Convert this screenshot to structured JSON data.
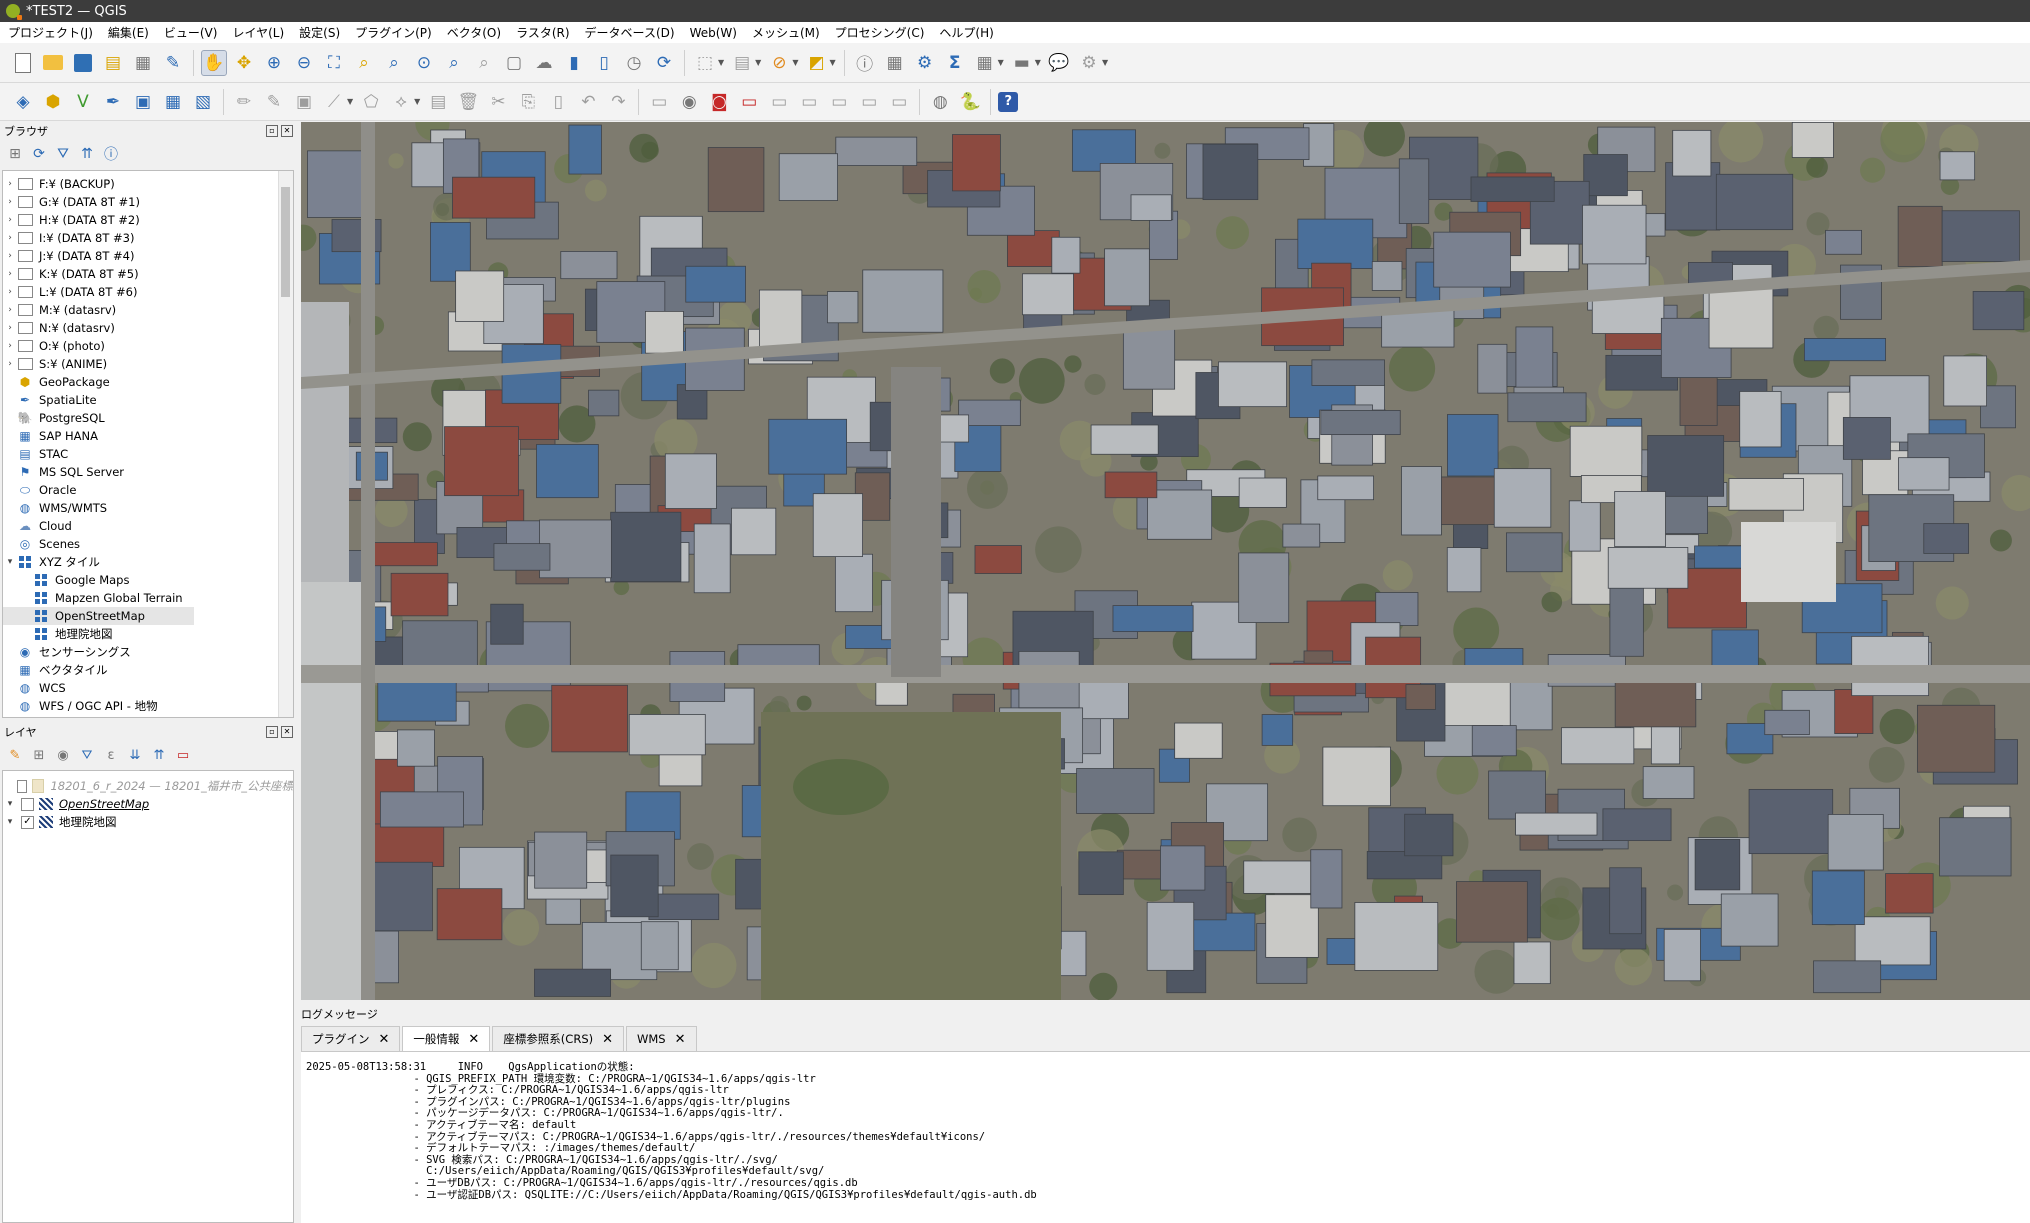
{
  "window": {
    "title": "*TEST2 — QGIS"
  },
  "menu": [
    "プロジェクト(J)",
    "編集(E)",
    "ビュー(V)",
    "レイヤ(L)",
    "設定(S)",
    "プラグイン(P)",
    "ベクタ(O)",
    "ラスタ(R)",
    "データベース(D)",
    "Web(W)",
    "メッシュ(M)",
    "プロセシング(C)",
    "ヘルプ(H)"
  ],
  "browser": {
    "title": "ブラウザ",
    "items": [
      {
        "label": "F:¥ (BACKUP)",
        "icon": "drive-icon",
        "expand": true,
        "indent": 0
      },
      {
        "label": "G:¥ (DATA 8T #1)",
        "icon": "drive-icon",
        "expand": true,
        "indent": 0
      },
      {
        "label": "H:¥ (DATA 8T #2)",
        "icon": "drive-icon",
        "expand": true,
        "indent": 0
      },
      {
        "label": "I:¥ (DATA 8T #3)",
        "icon": "drive-icon",
        "expand": true,
        "indent": 0
      },
      {
        "label": "J:¥ (DATA 8T #4)",
        "icon": "drive-icon",
        "expand": true,
        "indent": 0
      },
      {
        "label": "K:¥ (DATA 8T #5)",
        "icon": "drive-icon",
        "expand": true,
        "indent": 0
      },
      {
        "label": "L:¥ (DATA 8T #6)",
        "icon": "drive-icon",
        "expand": true,
        "indent": 0
      },
      {
        "label": "M:¥ (datasrv)",
        "icon": "drive-icon",
        "expand": true,
        "indent": 0
      },
      {
        "label": "N:¥ (datasrv)",
        "icon": "drive-icon",
        "expand": true,
        "indent": 0
      },
      {
        "label": "O:¥ (photo)",
        "icon": "drive-icon",
        "expand": true,
        "indent": 0
      },
      {
        "label": "S:¥ (ANIME)",
        "icon": "drive-icon",
        "expand": true,
        "indent": 0
      },
      {
        "label": "GeoPackage",
        "icon": "geopackage-icon",
        "expand": false,
        "indent": 0
      },
      {
        "label": "SpatiaLite",
        "icon": "spatialite-icon",
        "expand": false,
        "indent": 0
      },
      {
        "label": "PostgreSQL",
        "icon": "postgresql-icon",
        "expand": false,
        "indent": 0
      },
      {
        "label": "SAP HANA",
        "icon": "sap-hana-icon",
        "expand": false,
        "indent": 0
      },
      {
        "label": "STAC",
        "icon": "stac-icon",
        "expand": false,
        "indent": 0
      },
      {
        "label": "MS SQL Server",
        "icon": "mssql-icon",
        "expand": false,
        "indent": 0
      },
      {
        "label": "Oracle",
        "icon": "oracle-icon",
        "expand": false,
        "indent": 0
      },
      {
        "label": "WMS/WMTS",
        "icon": "globe-icon",
        "expand": false,
        "indent": 0
      },
      {
        "label": "Cloud",
        "icon": "cloud-icon",
        "expand": false,
        "indent": 0
      },
      {
        "label": "Scenes",
        "icon": "scenes-icon",
        "expand": false,
        "indent": 0
      },
      {
        "label": "XYZ タイル",
        "icon": "xyz-grid-icon",
        "expand": "open",
        "indent": 0
      },
      {
        "label": "Google Maps",
        "icon": "xyz-grid-icon",
        "expand": false,
        "indent": 1
      },
      {
        "label": "Mapzen Global Terrain",
        "icon": "xyz-grid-icon",
        "expand": false,
        "indent": 1
      },
      {
        "label": "OpenStreetMap",
        "icon": "xyz-grid-icon",
        "expand": false,
        "indent": 1,
        "selected": true
      },
      {
        "label": "地理院地図",
        "icon": "xyz-grid-icon",
        "expand": false,
        "indent": 1
      },
      {
        "label": "センサーシングス",
        "icon": "sensorthings-icon",
        "expand": false,
        "indent": 0
      },
      {
        "label": "ベクタタイル",
        "icon": "vector-tile-icon",
        "expand": false,
        "indent": 0
      },
      {
        "label": "WCS",
        "icon": "wcs-icon",
        "expand": false,
        "indent": 0
      },
      {
        "label": "WFS / OGC API - 地物",
        "icon": "wfs-icon",
        "expand": false,
        "indent": 0
      }
    ]
  },
  "layers": {
    "title": "レイヤ",
    "items": [
      {
        "label": "18201_6_r_2024 — 18201_福井市_公共座標",
        "checked": false,
        "muted": true,
        "type": "raster"
      },
      {
        "label": "OpenStreetMap",
        "checked": false,
        "muted": false,
        "italic": true,
        "type": "xyz"
      },
      {
        "label": "地理院地図",
        "checked": true,
        "muted": false,
        "type": "xyz"
      }
    ]
  },
  "log": {
    "title": "ログメッセージ",
    "tabs": [
      {
        "label": "プラグイン",
        "active": false
      },
      {
        "label": "一般情報",
        "active": true
      },
      {
        "label": "座標参照系(CRS)",
        "active": false
      },
      {
        "label": "WMS",
        "active": false
      }
    ],
    "lines": [
      "2025-05-08T13:58:31     INFO    QgsApplicationの状態:",
      "                 - QGIS_PREFIX_PATH 環境変数: C:/PROGRA~1/QGIS34~1.6/apps/qgis-ltr",
      "                 - プレフィクス: C:/PROGRA~1/QGIS34~1.6/apps/qgis-ltr",
      "                 - プラグインパス: C:/PROGRA~1/QGIS34~1.6/apps/qgis-ltr/plugins",
      "                 - パッケージデータパス: C:/PROGRA~1/QGIS34~1.6/apps/qgis-ltr/.",
      "                 - アクティブテーマ名: default",
      "                 - アクティブテーマパス: C:/PROGRA~1/QGIS34~1.6/apps/qgis-ltr/./resources/themes¥default¥icons/",
      "                 - デフォルトテーマパス: :/images/themes/default/",
      "                 - SVG 検索パス: C:/PROGRA~1/QGIS34~1.6/apps/qgis-ltr/./svg/",
      "                   C:/Users/eiich/AppData/Roaming/QGIS/QGIS3¥profiles¥default/svg/",
      "                 - ユーザDBパス: C:/PROGRA~1/QGIS34~1.6/apps/qgis-ltr/./resources/qgis.db",
      "                 - ユーザ認証DBパス: QSQLITE://C:/Users/eiich/AppData/Roaming/QGIS/QGIS3¥profiles¥default/qgis-auth.db"
    ]
  }
}
